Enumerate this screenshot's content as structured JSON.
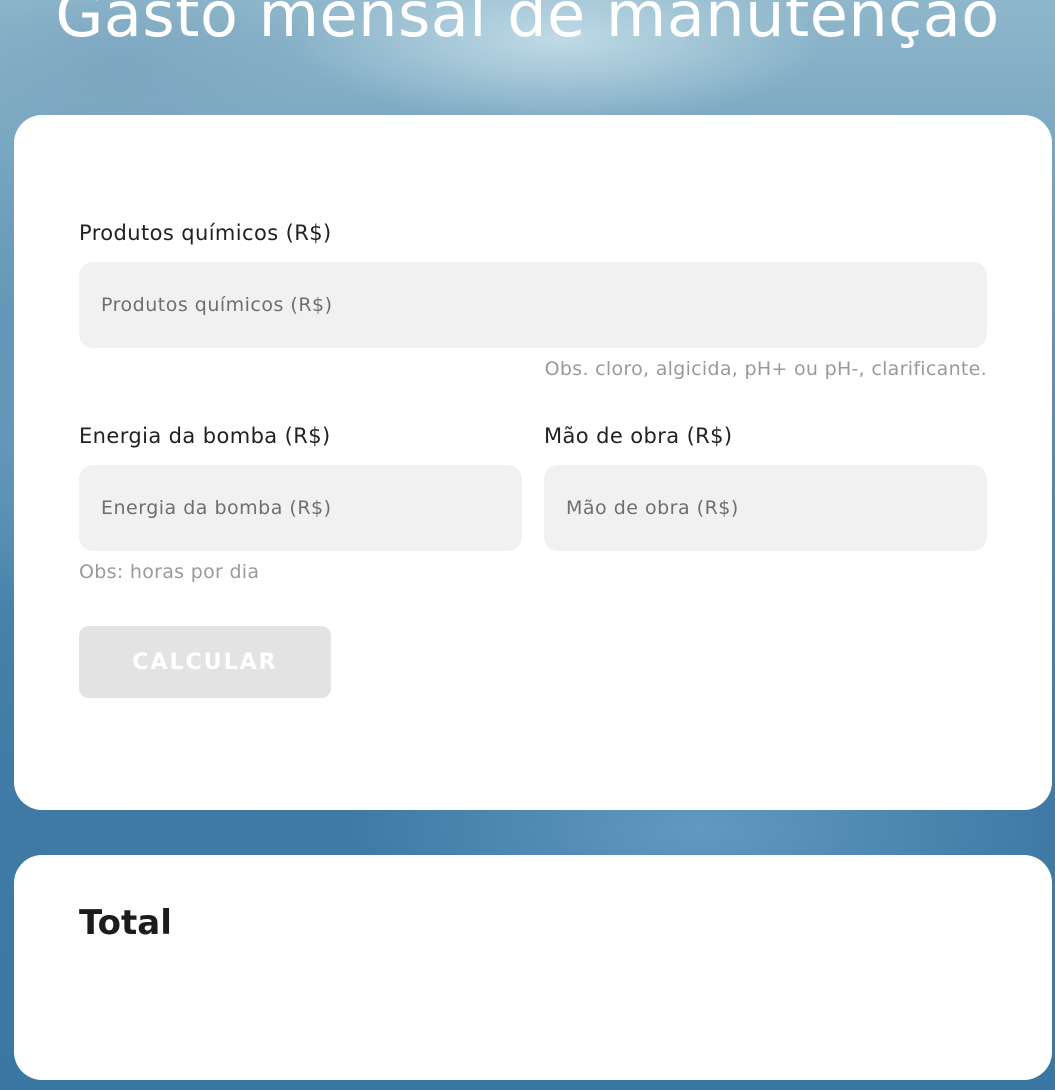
{
  "header": {
    "title": "Gasto mensal de manutenção"
  },
  "form": {
    "chemicals": {
      "label": "Produtos químicos (R$)",
      "placeholder": "Produtos químicos (R$)",
      "value": "",
      "hint": "Obs. cloro, algicida, pH+ ou pH-, clarificante."
    },
    "pump_energy": {
      "label": "Energia da bomba (R$)",
      "placeholder": "Energia da bomba (R$)",
      "value": "",
      "hint": "Obs: horas por dia"
    },
    "labor": {
      "label": "Mão de obra (R$)",
      "placeholder": "Mão de obra (R$)",
      "value": ""
    },
    "calculate_label": "CALCULAR"
  },
  "result": {
    "heading": "Total"
  }
}
